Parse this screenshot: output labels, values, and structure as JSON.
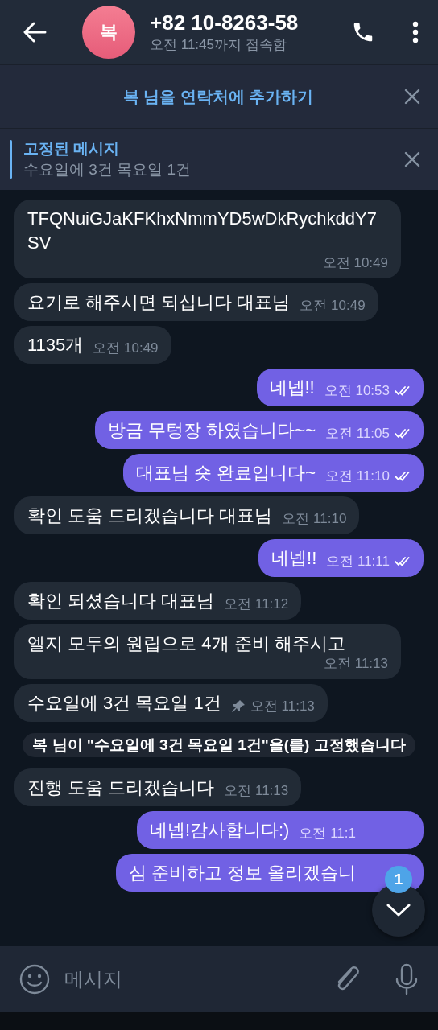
{
  "header": {
    "avatar_letter": "복",
    "title": "+82 10-8263-58",
    "status": "오전 11:45까지 접속함"
  },
  "add_contact": {
    "label": "복 님을 연락처에 추가하기"
  },
  "pinned": {
    "title": "고정된 메시지",
    "text": "수요일에 3건 목요일 1건"
  },
  "messages": [
    {
      "kind": "incoming",
      "text": "TFQNuiGJaKFKhxNmmYD5wDkRychkddY7SV",
      "time": "오전 10:49",
      "pinned": false
    },
    {
      "kind": "incoming",
      "text": "요기로 해주시면 되십니다 대표님",
      "time": "오전 10:49",
      "pinned": false
    },
    {
      "kind": "incoming",
      "text": "1135개",
      "time": "오전 10:49",
      "pinned": false
    },
    {
      "kind": "outgoing",
      "text": "네넵!!",
      "time": "오전 10:53",
      "read": true
    },
    {
      "kind": "outgoing",
      "text": "방금 무텅장 하였습니다~~",
      "time": "오전 11:05",
      "read": true
    },
    {
      "kind": "outgoing",
      "text": "대표님 숏 완료입니다~",
      "time": "오전 11:10",
      "read": true
    },
    {
      "kind": "incoming",
      "text": "확인 도움 드리겠습니다 대표님",
      "time": "오전 11:10",
      "pinned": false
    },
    {
      "kind": "outgoing",
      "text": "네넵!!",
      "time": "오전 11:11",
      "read": true
    },
    {
      "kind": "incoming",
      "text": "확인 되셨습니다 대표님",
      "time": "오전 11:12",
      "pinned": false
    },
    {
      "kind": "incoming",
      "text": "엘지 모두의 원립으로 4개 준비 해주시고",
      "time": "오전 11:13",
      "pinned": false
    },
    {
      "kind": "incoming",
      "text": "수요일에 3건 목요일 1건",
      "time": "오전 11:13",
      "pinned": true
    },
    {
      "kind": "service",
      "text": "복 님이 \"수요일에 3건 목요일 1건\"을(를) 고정했습니다"
    },
    {
      "kind": "incoming",
      "text": "진행 도움 드리겠습니다",
      "time": "오전 11:13",
      "pinned": false
    },
    {
      "kind": "outgoing",
      "text": "네넵!감사합니다:)",
      "time": "오전 11:1"
    },
    {
      "kind": "outgoing",
      "text": "심 준비하고 정보 올리겠습니"
    }
  ],
  "scroll_button": {
    "badge": "1"
  },
  "composer": {
    "placeholder": "메시지"
  }
}
